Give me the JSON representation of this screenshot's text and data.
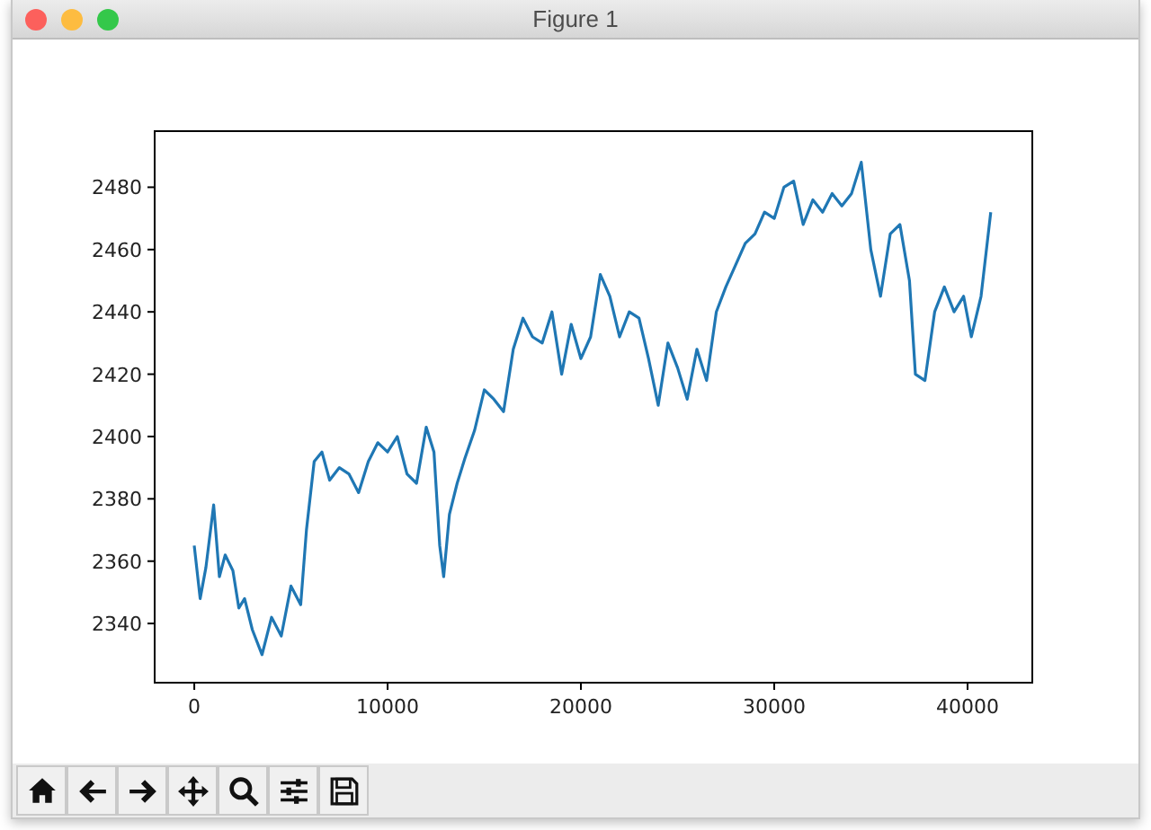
{
  "window": {
    "title": "Figure 1"
  },
  "figure": {
    "chart_data": {
      "type": "line",
      "xlim": [
        -2050,
        43350
      ],
      "ylim": [
        2321,
        2498
      ],
      "xticks": [
        0,
        10000,
        20000,
        30000,
        40000
      ],
      "yticks": [
        2340,
        2360,
        2380,
        2400,
        2420,
        2440,
        2460,
        2480
      ],
      "x": [
        0,
        300,
        600,
        1000,
        1300,
        1600,
        2000,
        2300,
        2600,
        3000,
        3500,
        4000,
        4500,
        5000,
        5500,
        5800,
        6200,
        6600,
        7000,
        7500,
        8000,
        8500,
        9000,
        9500,
        10000,
        10500,
        11000,
        11500,
        12000,
        12400,
        12700,
        12900,
        13200,
        13600,
        14000,
        14500,
        15000,
        15500,
        16000,
        16500,
        17000,
        17500,
        18000,
        18500,
        19000,
        19500,
        20000,
        20500,
        21000,
        21500,
        22000,
        22500,
        23000,
        23500,
        24000,
        24500,
        25000,
        25500,
        26000,
        26500,
        27000,
        27500,
        28000,
        28500,
        29000,
        29500,
        30000,
        30500,
        31000,
        31500,
        32000,
        32500,
        33000,
        33500,
        34000,
        34500,
        35000,
        35500,
        36000,
        36500,
        37000,
        37300,
        37800,
        38300,
        38800,
        39300,
        39800,
        40200,
        40700,
        41200
      ],
      "series": [
        {
          "color": "#1f77b4",
          "values": [
            2365,
            2348,
            2358,
            2378,
            2355,
            2362,
            2357,
            2345,
            2348,
            2338,
            2330,
            2342,
            2336,
            2352,
            2346,
            2370,
            2392,
            2395,
            2386,
            2390,
            2388,
            2382,
            2392,
            2398,
            2395,
            2400,
            2388,
            2385,
            2403,
            2395,
            2365,
            2355,
            2375,
            2385,
            2393,
            2402,
            2415,
            2412,
            2408,
            2428,
            2438,
            2432,
            2430,
            2440,
            2420,
            2436,
            2425,
            2432,
            2452,
            2445,
            2432,
            2440,
            2438,
            2425,
            2410,
            2430,
            2422,
            2412,
            2428,
            2418,
            2440,
            2448,
            2455,
            2462,
            2465,
            2472,
            2470,
            2480,
            2482,
            2468,
            2476,
            2472,
            2478,
            2474,
            2478,
            2488,
            2460,
            2445,
            2465,
            2468,
            2450,
            2420,
            2418,
            2440,
            2448,
            2440,
            2445,
            2432,
            2445,
            2472
          ]
        }
      ]
    }
  }
}
